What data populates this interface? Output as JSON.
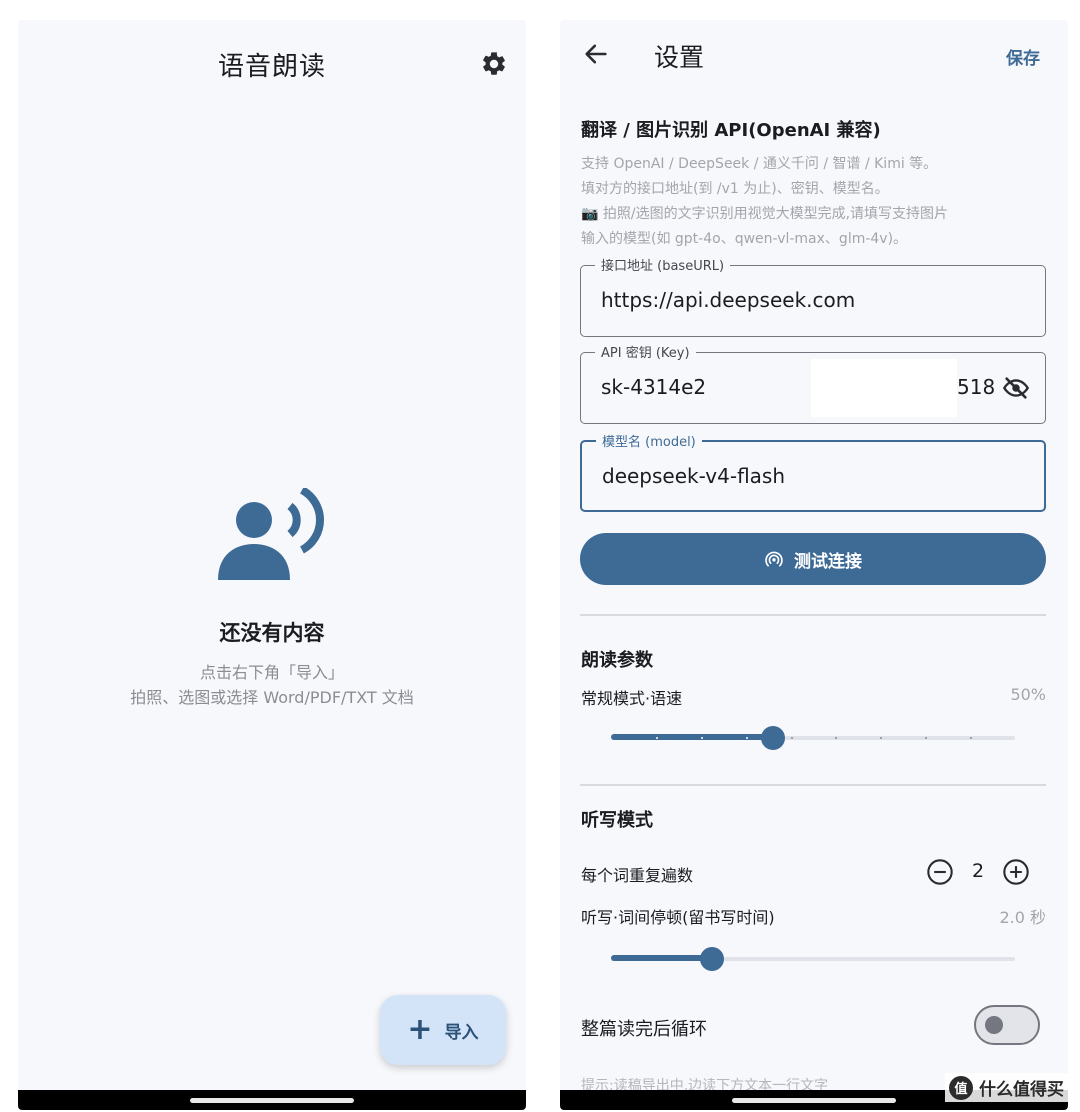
{
  "left": {
    "title": "语音朗读",
    "empty": {
      "title": "还没有内容",
      "hint_line1": "点击右下角「导入」",
      "hint_line2": "拍照、选图或选择 Word/PDF/TXT 文档"
    },
    "fab": {
      "icon": "plus-icon",
      "label": "导入"
    }
  },
  "right": {
    "header": {
      "title": "设置",
      "save_label": "保存"
    },
    "api_section": {
      "title": "翻译 / 图片识别 API(OpenAI 兼容)",
      "desc_lines": [
        "支持 OpenAI / DeepSeek / 通义千问 / 智谱 / Kimi 等。",
        "填对方的接口地址(到 /v1 为止)、密钥、模型名。",
        "📷 拍照/选图的文字识别用视觉大模型完成,请填写支持图片",
        "输入的模型(如 gpt-4o、qwen-vl-max、glm-4v)。"
      ],
      "base_url": {
        "label": "接口地址 (baseURL)",
        "value": "https://api.deepseek.com"
      },
      "api_key": {
        "label": "API 密钥 (Key)",
        "value_visible": "sk-4314e2",
        "value_tail": "518"
      },
      "model": {
        "label": "模型名 (model)",
        "value": "deepseek-v4-flash"
      },
      "test_button": "测试连接"
    },
    "reading_section": {
      "title": "朗读参数",
      "speed_label": "常规模式·语速",
      "speed_value": "50%",
      "speed_fraction": 0.4
    },
    "dictation_section": {
      "title": "听写模式",
      "repeat_label": "每个词重复遍数",
      "repeat_count": "2",
      "pause_label": "听写·词间停顿(留书写时间)",
      "pause_value": "2.0 秒",
      "pause_fraction": 0.25,
      "loop_label": "整篇读完后循环",
      "loop_enabled": false,
      "cut_off_text": "提示:读稿导出中,边读下方文本一行文字"
    }
  },
  "watermark": {
    "logo": "值",
    "text": "什么值得买"
  },
  "colors": {
    "primary": "#3e6a96",
    "background": "#f7f8fb",
    "fab_bg": "#d3e4f8"
  }
}
